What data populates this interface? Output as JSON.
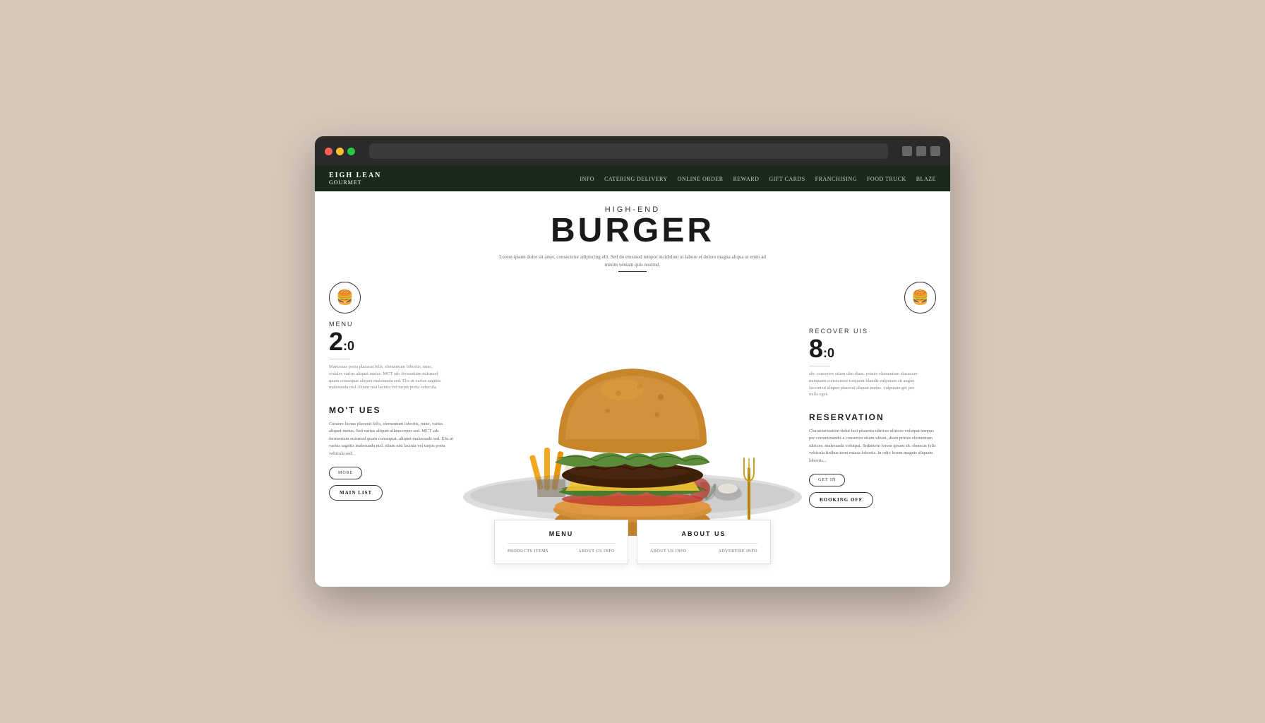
{
  "browser": {
    "traffic_lights": [
      "red",
      "yellow",
      "green"
    ]
  },
  "nav": {
    "logo_main": "EIGH LEAN",
    "logo_sub": "GOURMET",
    "links": [
      "INFO",
      "CATERING DELIVERY",
      "ONLINE ORDER",
      "REWARD",
      "GIFT CARDS",
      "FRANCHISING",
      "FOOD TRUCK",
      "BLAZE"
    ]
  },
  "hero": {
    "subtitle": "HIGH-END",
    "title": "BURGER",
    "description": "Lorem ipsum dolor sit amet, consectetur adipiscing elit. Sed do eiusmod tempor incididunt ut labore et dolore magna aliqua ut enim ad minim veniam quis nostrud."
  },
  "left_panel": {
    "stat_label": "MENU",
    "stat_number": "2",
    "stat_suffix": ":0",
    "stat_desc": "Maecenas porta placerat felis, elementum lobortis, nunc, sodales varius aliquet metus. MCT ads fermentum euismod quam consequat aliquet malesuada sed. Elis ut varius sagittis malesuada nisl. Etiam nisi lacinia vel turpis porta vehicula.",
    "section_heading": "MO'T UES",
    "section_text": "Curaore luctus placerat felis, elementum lobortis, nunc, varius aliquet metus. Sed varius aliquet ullamcorper sed. MCT ads fermentum euismod quam consequat. aliquet malesuada sed. Elis ut varius sagittis malesuada nisl. etiam nisi lacinia vel turpis porta vehicula sed.",
    "btn_small_label": "MORE",
    "btn_large_label": "MAIN LIST"
  },
  "right_panel": {
    "stat_label": "RECOVER UIS",
    "stat_number": "8",
    "stat_suffix": ":0",
    "stat_desc": "abc consertos etiam ulm diam. primis elementum slussuere-nunquam consectetur torquent blandit vulputate sit augue laceret ut aliquet placerat aliquat metus. vulputate get per nulla eget.",
    "section_heading": "RESERVATION",
    "section_text": "Characterization dolut luct pharetra ultrices ultrices volutpat tempus per communando-a consertos etiam ultum- diam primis elementum ultrices. malesuada volutpat. Srdantem lorem ipsum sit. rhoncus felis vehicula finibus toret massa lobortis. in odio lorem magnis aliquam lobortis...",
    "btn_small_label": "GET IN",
    "btn_large_label": "BOOKING OFF"
  },
  "bottom_cards": [
    {
      "title": "MENU",
      "link1": "PRODUCTS ITEMS",
      "link2": "ABOUT US INFO"
    },
    {
      "title": "ABOUT US",
      "link1": "ABOUT US INFO",
      "link2": "ADVERTISE INFO"
    }
  ],
  "colors": {
    "nav_bg": "#1a2a1a",
    "page_bg": "#d9c9bb",
    "white": "#ffffff",
    "dark": "#1a1a1a",
    "accent": "#c0392b"
  }
}
